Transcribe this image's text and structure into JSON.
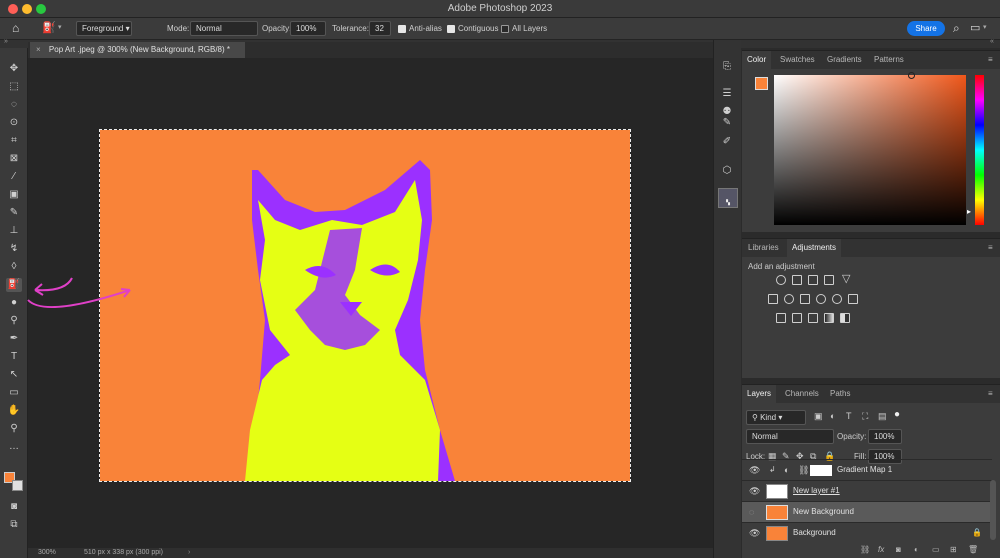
{
  "app": {
    "title": "Adobe Photoshop 2023",
    "share_label": "Share"
  },
  "options": {
    "fill_source": "Foreground",
    "mode_label": "Mode:",
    "mode_value": "Normal",
    "opacity_label": "Opacity:",
    "opacity_value": "100%",
    "tolerance_label": "Tolerance:",
    "tolerance_value": "32",
    "antialias_label": "Anti-alias",
    "antialias_checked": true,
    "contiguous_label": "Contiguous",
    "contiguous_checked": true,
    "all_layers_label": "All Layers",
    "all_layers_checked": false
  },
  "document": {
    "tab_title": "Pop Art .jpeg @ 300% (New Background, RGB/8) *",
    "zoom": "300%",
    "dimensions": "510 px x 338 px (300 ppi)",
    "background_color": "#f98339",
    "cat_outline_color": "#9b30ff",
    "cat_fill_color": "#e5ff14"
  },
  "color_panel": {
    "tabs": [
      "Color",
      "Swatches",
      "Gradients",
      "Patterns"
    ],
    "foreground": "#f98339",
    "background": "#e0e0e0"
  },
  "adjust_panel": {
    "tabs": [
      "Libraries",
      "Adjustments"
    ],
    "add_label": "Add an adjustment"
  },
  "layers_panel": {
    "tabs": [
      "Layers",
      "Channels",
      "Paths"
    ],
    "kind_label": "Kind",
    "blend_mode": "Normal",
    "opacity_label": "Opacity:",
    "opacity_value": "100%",
    "lock_label": "Lock:",
    "fill_label": "Fill:",
    "fill_value": "100%",
    "layers": [
      {
        "name": "Gradient Map 1"
      },
      {
        "name": "New layer #1"
      },
      {
        "name": "New Background"
      },
      {
        "name": "Background"
      }
    ]
  },
  "annotation": {
    "arrow_color": "#e040c8"
  }
}
